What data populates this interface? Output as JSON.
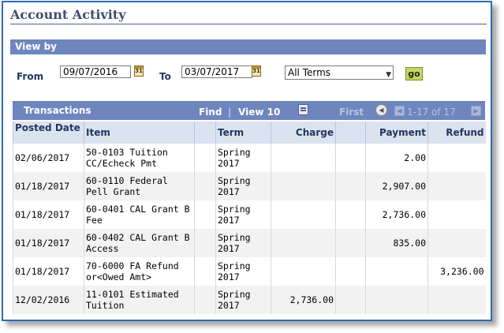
{
  "page_title": "Account Activity",
  "view_by": {
    "label": "View by",
    "from_label": "From",
    "from_value": "09/07/2016",
    "to_label": "To",
    "to_value": "03/07/2017",
    "calendar_icon_text": "31",
    "term_selected": "All Terms",
    "go_label": "go"
  },
  "grid": {
    "title": "Transactions",
    "find": "Find",
    "separator": "|",
    "view_all": "View 10",
    "first": "First",
    "range": "1-17 of 17",
    "columns": [
      "Posted Date",
      "",
      "Item",
      "",
      "Term",
      "Charge",
      "",
      "Payment",
      "Refund"
    ],
    "rows": [
      {
        "posted": "02/06/2017",
        "item": "50-0103 Tuition CC/Echeck Pmt",
        "term": "Spring 2017",
        "charge": "",
        "payment": "2.00",
        "refund": ""
      },
      {
        "posted": "01/18/2017",
        "item": "60-0110 Federal Pell Grant",
        "term": "Spring 2017",
        "charge": "",
        "payment": "2,907.00",
        "refund": ""
      },
      {
        "posted": "01/18/2017",
        "item": "60-0401 CAL Grant B Fee",
        "term": "Spring 2017",
        "charge": "",
        "payment": "2,736.00",
        "refund": ""
      },
      {
        "posted": "01/18/2017",
        "item": "60-0402 CAL Grant B Access",
        "term": "Spring 2017",
        "charge": "",
        "payment": "835.00",
        "refund": ""
      },
      {
        "posted": "01/18/2017",
        "item": "70-6000 FA Refund or<Owed Amt>",
        "term": "Spring 2017",
        "charge": "",
        "payment": "",
        "refund": "3,236.00"
      },
      {
        "posted": "12/02/2016",
        "item": "11-0101 Estimated Tuition",
        "term": "Spring 2017",
        "charge": "2,736.00",
        "payment": "",
        "refund": ""
      }
    ]
  },
  "colors": {
    "header_bar": "#6e86bd",
    "title_text": "#3f4e6e",
    "frame_border": "#2d6bb3",
    "go_button": "#c5d66a"
  }
}
